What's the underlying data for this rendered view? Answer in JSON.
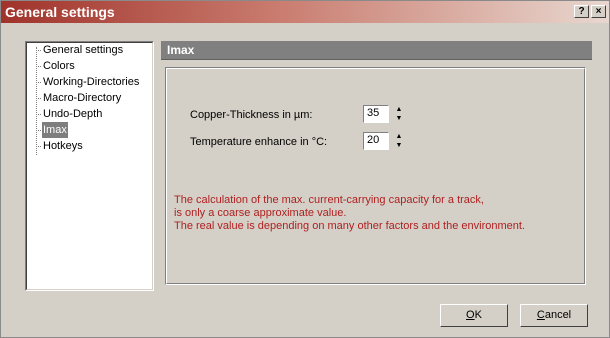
{
  "window": {
    "title": "General settings"
  },
  "titlebar_buttons": {
    "help": "?",
    "close": "×"
  },
  "tree": {
    "items": [
      {
        "label": "General settings",
        "selected": false
      },
      {
        "label": "Colors",
        "selected": false
      },
      {
        "label": "Working-Directories",
        "selected": false
      },
      {
        "label": "Macro-Directory",
        "selected": false
      },
      {
        "label": "Undo-Depth",
        "selected": false
      },
      {
        "label": "Imax",
        "selected": true
      },
      {
        "label": "Hotkeys",
        "selected": false
      }
    ]
  },
  "panel": {
    "header": "Imax",
    "copper": {
      "label": "Copper-Thickness in µm:",
      "value": "35"
    },
    "temperature": {
      "label": "Temperature enhance in °C:",
      "value": "20"
    },
    "note_lines": [
      "The calculation of the max. current-carrying capacity for a track,",
      "is only a coarse approximate value.",
      "The real value is depending on many other factors and the environment."
    ],
    "note_color": "#b02020"
  },
  "buttons": {
    "ok": {
      "mnemonic": "O",
      "rest": "K"
    },
    "cancel": {
      "mnemonic": "C",
      "rest": "ancel"
    }
  },
  "colors": {
    "title_gradient_start": "#a0332b",
    "face": "#d4d0c8",
    "header": "#808080",
    "selection": "#7e7e7e"
  }
}
